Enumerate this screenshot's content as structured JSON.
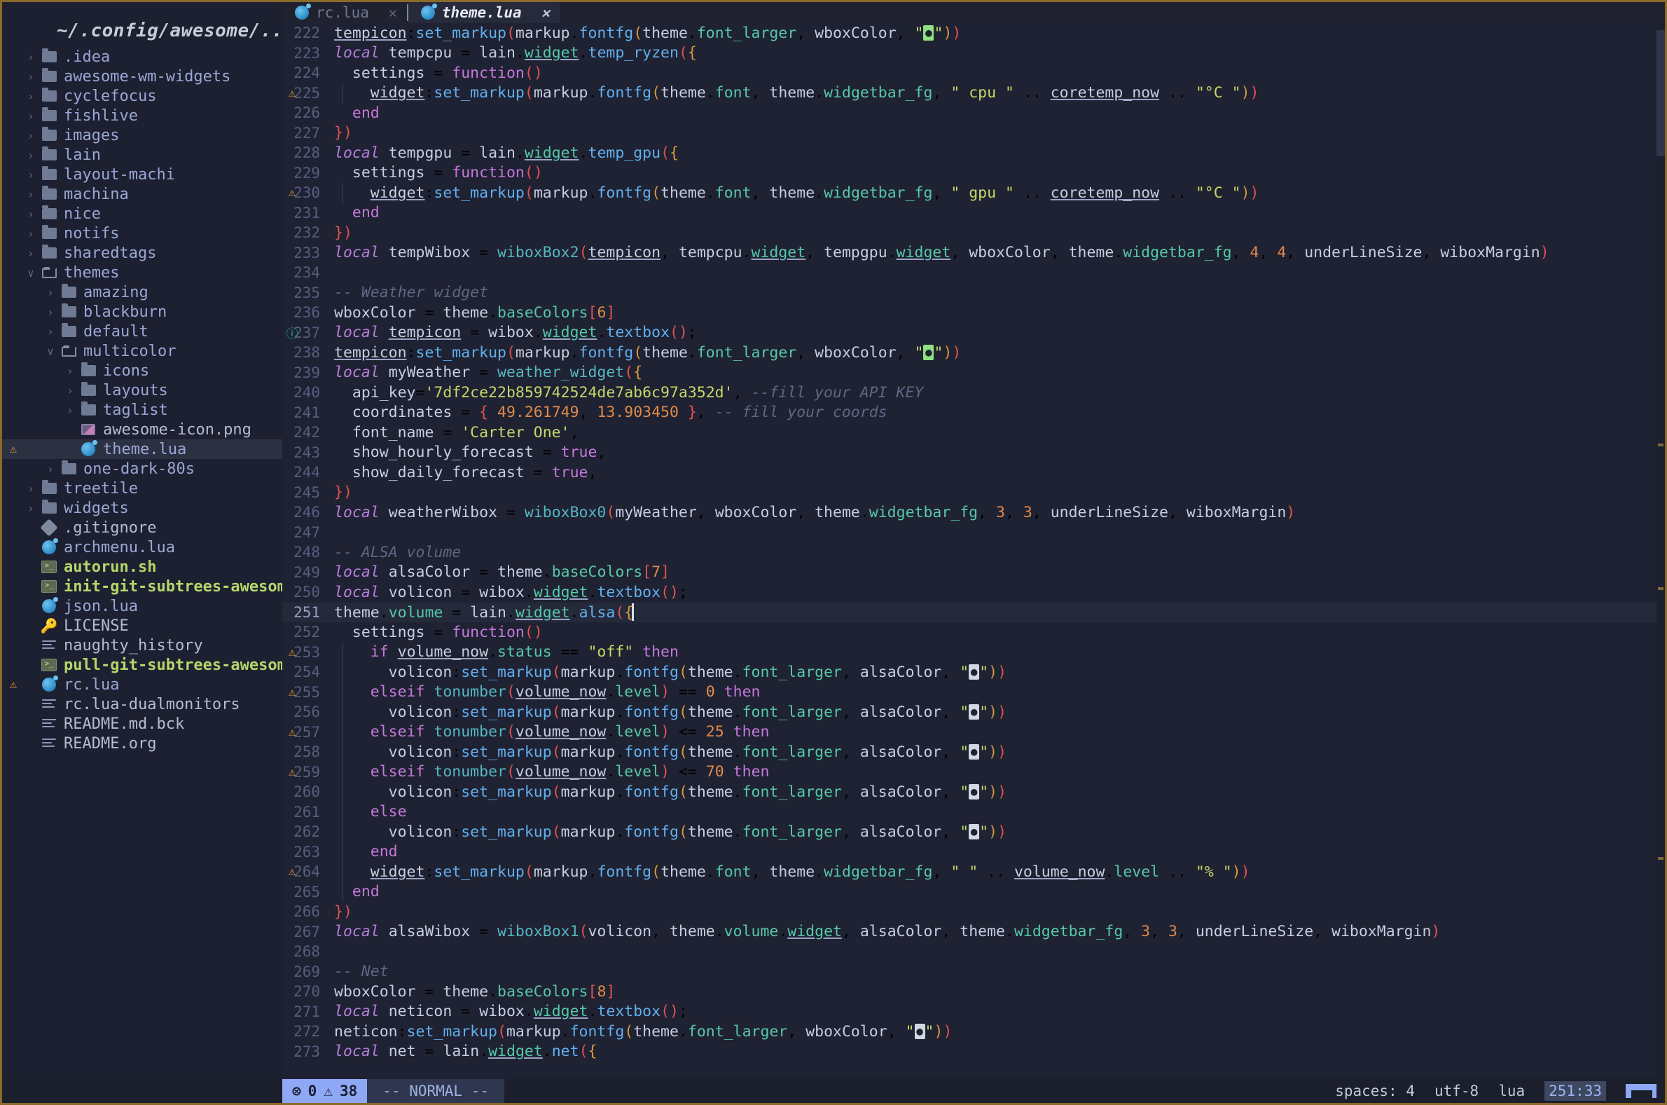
{
  "window": {
    "border_color": "#8a6a2a"
  },
  "sidebar": {
    "project_title": "~/.config/awesome/..",
    "items": [
      {
        "label": ".idea",
        "icon": "folder-icon",
        "depth": 1,
        "chev": "›",
        "kind": "dir"
      },
      {
        "label": "awesome-wm-widgets",
        "icon": "folder-icon",
        "depth": 1,
        "chev": "›",
        "kind": "dir"
      },
      {
        "label": "cyclefocus",
        "icon": "folder-icon",
        "depth": 1,
        "chev": "›",
        "kind": "dir"
      },
      {
        "label": "fishlive",
        "icon": "folder-icon",
        "depth": 1,
        "chev": "›",
        "kind": "dir"
      },
      {
        "label": "images",
        "icon": "folder-icon",
        "depth": 1,
        "chev": "›",
        "kind": "dir"
      },
      {
        "label": "lain",
        "icon": "folder-icon",
        "depth": 1,
        "chev": "›",
        "kind": "dir"
      },
      {
        "label": "layout-machi",
        "icon": "folder-icon",
        "depth": 1,
        "chev": "›",
        "kind": "dir"
      },
      {
        "label": "machina",
        "icon": "folder-icon",
        "depth": 1,
        "chev": "›",
        "kind": "dir"
      },
      {
        "label": "nice",
        "icon": "folder-icon",
        "depth": 1,
        "chev": "›",
        "kind": "dir"
      },
      {
        "label": "notifs",
        "icon": "folder-icon",
        "depth": 1,
        "chev": "›",
        "kind": "dir"
      },
      {
        "label": "sharedtags",
        "icon": "folder-icon",
        "depth": 1,
        "chev": "›",
        "kind": "dir"
      },
      {
        "label": "themes",
        "icon": "folder-open-icon",
        "depth": 1,
        "chev": "∨",
        "kind": "dir-open"
      },
      {
        "label": "amazing",
        "icon": "folder-icon",
        "depth": 2,
        "chev": "›",
        "kind": "dir"
      },
      {
        "label": "blackburn",
        "icon": "folder-icon",
        "depth": 2,
        "chev": "›",
        "kind": "dir"
      },
      {
        "label": "default",
        "icon": "folder-icon",
        "depth": 2,
        "chev": "›",
        "kind": "dir"
      },
      {
        "label": "multicolor",
        "icon": "folder-open-icon",
        "depth": 2,
        "chev": "∨",
        "kind": "dir-open"
      },
      {
        "label": "icons",
        "icon": "folder-icon",
        "depth": 3,
        "chev": "›",
        "kind": "dir"
      },
      {
        "label": "layouts",
        "icon": "folder-icon",
        "depth": 3,
        "chev": "›",
        "kind": "dir"
      },
      {
        "label": "taglist",
        "icon": "folder-icon",
        "depth": 3,
        "chev": "›",
        "kind": "dir"
      },
      {
        "label": "awesome-icon.png",
        "icon": "image-file-icon",
        "depth": 3,
        "chev": "",
        "kind": "png"
      },
      {
        "label": "theme.lua",
        "icon": "lua-file-icon",
        "depth": 3,
        "chev": "",
        "kind": "lua",
        "selected": true,
        "warning": "⚠"
      },
      {
        "label": "one-dark-80s",
        "icon": "folder-icon",
        "depth": 2,
        "chev": "›",
        "kind": "dir"
      },
      {
        "label": "treetile",
        "icon": "folder-icon",
        "depth": 1,
        "chev": "›",
        "kind": "dir"
      },
      {
        "label": "widgets",
        "icon": "folder-icon",
        "depth": 1,
        "chev": "›",
        "kind": "dir"
      },
      {
        "label": ".gitignore",
        "icon": "git-file-icon",
        "depth": 1,
        "chev": "",
        "kind": "git"
      },
      {
        "label": "archmenu.lua",
        "icon": "lua-file-icon",
        "depth": 1,
        "chev": "",
        "kind": "lua"
      },
      {
        "label": "autorun.sh",
        "icon": "shell-file-icon",
        "depth": 1,
        "chev": "",
        "kind": "sh"
      },
      {
        "label": "init-git-subtrees-awesom",
        "icon": "shell-file-icon",
        "depth": 1,
        "chev": "",
        "kind": "sh"
      },
      {
        "label": "json.lua",
        "icon": "lua-file-icon",
        "depth": 1,
        "chev": "",
        "kind": "lua"
      },
      {
        "label": "LICENSE",
        "icon": "key-icon",
        "depth": 1,
        "chev": "",
        "kind": "license"
      },
      {
        "label": "naughty_history",
        "icon": "text-file-icon",
        "depth": 1,
        "chev": "",
        "kind": "txt"
      },
      {
        "label": "pull-git-subtrees-awesom",
        "icon": "shell-file-icon",
        "depth": 1,
        "chev": "",
        "kind": "sh"
      },
      {
        "label": "rc.lua",
        "icon": "lua-file-icon",
        "depth": 1,
        "chev": "",
        "kind": "lua",
        "warning": "⚠"
      },
      {
        "label": "rc.lua-dualmonitors",
        "icon": "text-file-icon",
        "depth": 1,
        "chev": "",
        "kind": "txt"
      },
      {
        "label": "README.md.bck",
        "icon": "text-file-icon",
        "depth": 1,
        "chev": "",
        "kind": "txt"
      },
      {
        "label": "README.org",
        "icon": "text-file-icon",
        "depth": 1,
        "chev": "",
        "kind": "txt"
      }
    ]
  },
  "tabs": [
    {
      "label": "rc.lua",
      "icon": "lua-file-icon",
      "close": "✕",
      "active": false
    },
    {
      "label": "theme.lua",
      "icon": "lua-file-icon",
      "close": "✕",
      "active": true
    }
  ],
  "editor": {
    "language": "lua",
    "first_line": 222,
    "cursor_line": 251,
    "lines": [
      {
        "n": 222,
        "marker": "",
        "text": "tempicon:set_markup(markup.fontfg(theme.font_larger, wboxColor, \"🌡\"))"
      },
      {
        "n": 223,
        "marker": "",
        "text": "local tempcpu = lain.widget.temp_ryzen({"
      },
      {
        "n": 224,
        "marker": "",
        "text": "  settings = function()"
      },
      {
        "n": 225,
        "marker": "warning",
        "text": "    widget:set_markup(markup.fontfg(theme.font, theme.widgetbar_fg, \" cpu \" .. coretemp_now .. \"°C \"))"
      },
      {
        "n": 226,
        "marker": "",
        "text": "  end"
      },
      {
        "n": 227,
        "marker": "",
        "text": "})"
      },
      {
        "n": 228,
        "marker": "",
        "text": "local tempgpu = lain.widget.temp_gpu({"
      },
      {
        "n": 229,
        "marker": "",
        "text": "  settings = function()"
      },
      {
        "n": 230,
        "marker": "warning",
        "text": "    widget:set_markup(markup.fontfg(theme.font, theme.widgetbar_fg, \" gpu \" .. coretemp_now .. \"°C \"))"
      },
      {
        "n": 231,
        "marker": "",
        "text": "  end"
      },
      {
        "n": 232,
        "marker": "",
        "text": "})"
      },
      {
        "n": 233,
        "marker": "",
        "text": "local tempWibox = wiboxBox2(tempicon, tempcpu.widget, tempgpu.widget, wboxColor, theme.widgetbar_fg, 4, 4, underLineSize, wiboxMargin)"
      },
      {
        "n": 234,
        "marker": "",
        "text": ""
      },
      {
        "n": 235,
        "marker": "",
        "text": "-- Weather widget"
      },
      {
        "n": 236,
        "marker": "",
        "text": "wboxColor = theme.baseColors[6]"
      },
      {
        "n": 237,
        "marker": "info",
        "text": "local tempicon = wibox.widget.textbox();"
      },
      {
        "n": 238,
        "marker": "",
        "text": "tempicon:set_markup(markup.fontfg(theme.font_larger, wboxColor, \"🌡\"))"
      },
      {
        "n": 239,
        "marker": "",
        "text": "local myWeather = weather_widget({"
      },
      {
        "n": 240,
        "marker": "",
        "text": "  api_key='7df2ce22b859742524de7ab6c97a352d', --fill your API KEY"
      },
      {
        "n": 241,
        "marker": "",
        "text": "  coordinates = { 49.261749, 13.903450 }, -- fill your coords"
      },
      {
        "n": 242,
        "marker": "",
        "text": "  font_name = 'Carter One',"
      },
      {
        "n": 243,
        "marker": "",
        "text": "  show_hourly_forecast = true,"
      },
      {
        "n": 244,
        "marker": "",
        "text": "  show_daily_forecast = true,"
      },
      {
        "n": 245,
        "marker": "",
        "text": "})"
      },
      {
        "n": 246,
        "marker": "",
        "text": "local weatherWibox = wiboxBox0(myWeather, wboxColor, theme.widgetbar_fg, 3, 3, underLineSize, wiboxMargin)"
      },
      {
        "n": 247,
        "marker": "",
        "text": ""
      },
      {
        "n": 248,
        "marker": "",
        "text": "-- ALSA volume"
      },
      {
        "n": 249,
        "marker": "",
        "text": "local alsaColor = theme.baseColors[7]"
      },
      {
        "n": 250,
        "marker": "",
        "text": "local volicon = wibox.widget.textbox();"
      },
      {
        "n": 251,
        "marker": "",
        "text": "theme.volume = lain.widget.alsa({",
        "current": true
      },
      {
        "n": 252,
        "marker": "",
        "text": "  settings = function()"
      },
      {
        "n": 253,
        "marker": "warning",
        "text": "    if volume_now.status == \"off\" then"
      },
      {
        "n": 254,
        "marker": "",
        "text": "      volicon:set_markup(markup.fontfg(theme.font_larger, alsaColor, \"🔇\"))"
      },
      {
        "n": 255,
        "marker": "warning",
        "text": "    elseif tonumber(volume_now.level) == 0 then"
      },
      {
        "n": 256,
        "marker": "",
        "text": "      volicon:set_markup(markup.fontfg(theme.font_larger, alsaColor, \"🔈\"))"
      },
      {
        "n": 257,
        "marker": "warning",
        "text": "    elseif tonumber(volume_now.level) <= 25 then"
      },
      {
        "n": 258,
        "marker": "",
        "text": "      volicon:set_markup(markup.fontfg(theme.font_larger, alsaColor, \"🔉\"))"
      },
      {
        "n": 259,
        "marker": "warning",
        "text": "    elseif tonumber(volume_now.level) <= 70 then"
      },
      {
        "n": 260,
        "marker": "",
        "text": "      volicon:set_markup(markup.fontfg(theme.font_larger, alsaColor, \"🔊 \"))"
      },
      {
        "n": 261,
        "marker": "",
        "text": "    else"
      },
      {
        "n": 262,
        "marker": "",
        "text": "      volicon:set_markup(markup.fontfg(theme.font_larger, alsaColor, \"🔊\"))"
      },
      {
        "n": 263,
        "marker": "",
        "text": "    end"
      },
      {
        "n": 264,
        "marker": "warning",
        "text": "    widget:set_markup(markup.fontfg(theme.font, theme.widgetbar_fg, \" \" .. volume_now.level .. \"% \"))"
      },
      {
        "n": 265,
        "marker": "",
        "text": "  end"
      },
      {
        "n": 266,
        "marker": "",
        "text": "})"
      },
      {
        "n": 267,
        "marker": "",
        "text": "local alsaWibox = wiboxBox1(volicon, theme.volume.widget, alsaColor, theme.widgetbar_fg, 3, 3, underLineSize, wiboxMargin)"
      },
      {
        "n": 268,
        "marker": "",
        "text": ""
      },
      {
        "n": 269,
        "marker": "",
        "text": "-- Net"
      },
      {
        "n": 270,
        "marker": "",
        "text": "wboxColor = theme.baseColors[8]"
      },
      {
        "n": 271,
        "marker": "",
        "text": "local neticon = wibox.widget.textbox();"
      },
      {
        "n": 272,
        "marker": "",
        "text": "neticon:set_markup(markup.fontfg(theme.font_larger, wboxColor, \"💻\"))"
      },
      {
        "n": 273,
        "marker": "",
        "text": "local net = lain.widget.net({"
      }
    ]
  },
  "statusbar": {
    "error_icon": "⊗",
    "error_count": "0",
    "warning_icon": "⚠",
    "warning_count": "38",
    "mode": "-- NORMAL --",
    "indent": "spaces: 4",
    "encoding": "utf-8",
    "filetype": "lua",
    "position": "251:33"
  }
}
